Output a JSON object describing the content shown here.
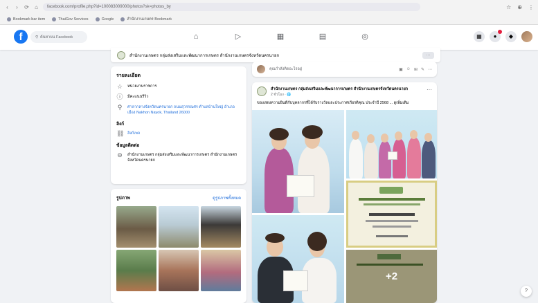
{
  "browser": {
    "url": "facebook.com/profile.php?id=100083009000/photos?sk=photos_by",
    "bookmarks": [
      "Bookmark bar item",
      "ThaiGov Services",
      "Google",
      "สำนักงานเกษตร Bookmark"
    ],
    "icons": {
      "back": "‹",
      "forward": "›",
      "reload": "⟳",
      "home": "⌂",
      "star": "☆",
      "ext": "⊕",
      "menu": "⋮"
    }
  },
  "facebook": {
    "logo": "f",
    "search_placeholder": "ค้นหาบน Facebook",
    "nav_icons": [
      "⌂",
      "▷",
      "▦",
      "▤",
      "◎"
    ],
    "right_icons": [
      "▦",
      "●",
      "◆"
    ]
  },
  "page_header": {
    "title": "สำนักงานเกษตร กลุ่มส่งเสริมและพัฒนาการเกษตร สำนักงานเกษตรจังหวัดนครนายก",
    "more": "···"
  },
  "intro": {
    "heading": "รายละเอียด",
    "rows": [
      {
        "icon": "☆",
        "text": "หน่วยงานราชการ",
        "link": false
      },
      {
        "icon": "ⓘ",
        "text": "มีคะแนนรีวิว",
        "link": false
      },
      {
        "icon": "⚲",
        "text": "ศาลากลางจังหวัดนครนายก ถนนสุวรรณศร ตำบลบ้านใหญ่ อำเภอเมือง Nakhon Nayok, Thailand 26000",
        "link": true
      }
    ],
    "links_heading": "ลิงก์",
    "links": [
      {
        "icon": "⛓",
        "text": "ลิงก์เพจ"
      }
    ],
    "contact_heading": "ข้อมูลติดต่อ",
    "contact": {
      "icon": "⊖",
      "text": "สำนักงานเกษตร กลุ่มส่งเสริมและพัฒนาการเกษตร สำนักงานเกษตรจังหวัดนครนายก"
    }
  },
  "photos": {
    "heading": "รูปภาพ",
    "see_all": "ดูรูปภาพทั้งหมด"
  },
  "composer": {
    "placeholder": "คุณกำลังคิดอะไรอยู่",
    "actions": [
      "▣",
      "☺",
      "⊞",
      "✎",
      "⋯"
    ]
  },
  "post": {
    "author": "สำนักงานเกษตร กลุ่มส่งเสริมและพัฒนาการเกษตร สำนักงานเกษตรจังหวัดนครนายก",
    "time": "2 ชั่วโมง · 🌐",
    "text": "ขอแสดงความยินดีกับบุคลากรที่ได้รับรางวัลและประกาศเกียรติคุณ ประจำปี 2568 ... ดูเพิ่มเติม",
    "more_count": "+2",
    "cert_header": "สำนักงานเกษตรจังหวัด"
  },
  "help_icon": "?"
}
